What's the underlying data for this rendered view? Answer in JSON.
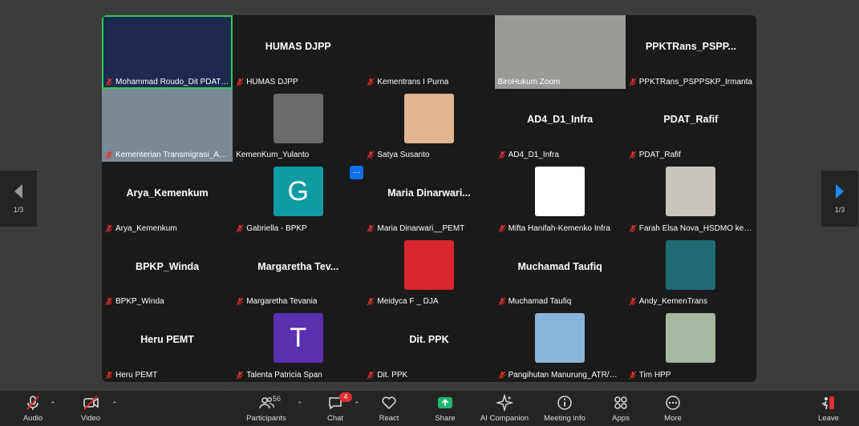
{
  "tiles": [
    {
      "name": "Mohammad Roudo_Dit PDAT Ba...",
      "big": "",
      "kind": "video",
      "bg": "#1d2a4f",
      "active": true
    },
    {
      "name": "HUMAS DJPP",
      "big": "HUMAS DJPP",
      "kind": "name"
    },
    {
      "name": "Kementrans I Purna",
      "big": "",
      "kind": "blank"
    },
    {
      "name": "BiroHukum Zoom",
      "big": "",
      "kind": "video",
      "bg": "#9a9a96",
      "muted": false
    },
    {
      "name": "PPKTRans_PSPPSKP_Irmanta",
      "big": "PPKTRans_PSPP...",
      "kind": "name"
    },
    {
      "name": "Kementerian Transmigrasi_Ab...",
      "big": "",
      "kind": "video",
      "bg": "#7b8a95"
    },
    {
      "name": "KemenKum_Yulanto",
      "big": "",
      "kind": "photo",
      "bg": "#6a6a6a",
      "muted": false
    },
    {
      "name": "Satya Susanto",
      "big": "",
      "kind": "photo",
      "bg": "#e0b590"
    },
    {
      "name": "AD4_D1_Infra",
      "big": "AD4_D1_Infra",
      "kind": "name"
    },
    {
      "name": "PDAT_Rafif",
      "big": "PDAT_Rafif",
      "kind": "name"
    },
    {
      "name": "Arya_Kemenkum",
      "big": "Arya_Kemenkum",
      "kind": "name"
    },
    {
      "name": "Gabriella - BPKP",
      "big": "",
      "kind": "letter",
      "letter": "G",
      "bg": "#0e9ba4"
    },
    {
      "name": "Maria Dinarwari__PEMT",
      "big": "Maria  Dinarwari...",
      "kind": "name"
    },
    {
      "name": "Mifta Hanifah-Kemenko Infra",
      "big": "",
      "kind": "photo",
      "bg": "#ffffff"
    },
    {
      "name": "Farah Elsa Nova_HSDMO kem...",
      "big": "",
      "kind": "photo",
      "bg": "#c9c4bc"
    },
    {
      "name": "BPKP_Winda",
      "big": "BPKP_Winda",
      "kind": "name"
    },
    {
      "name": "Margaretha Tevania",
      "big": "Margaretha  Tev...",
      "kind": "name"
    },
    {
      "name": "Meidyca F _ DJA",
      "big": "",
      "kind": "photo",
      "bg": "#d8262a"
    },
    {
      "name": "Muchamad Taufiq",
      "big": "Muchamad Taufiq",
      "kind": "name"
    },
    {
      "name": "Andy_KemenTrans",
      "big": "",
      "kind": "photo",
      "bg": "#1f6b73"
    },
    {
      "name": "Heru PEMT",
      "big": "Heru PEMT",
      "kind": "name"
    },
    {
      "name": "Talenta Patricia Span",
      "big": "",
      "kind": "letter",
      "letter": "T",
      "bg": "#5a30b0"
    },
    {
      "name": "Dit. PPK",
      "big": "Dit. PPK",
      "kind": "name"
    },
    {
      "name": "Pangihutan Manurung_ATR/BP...",
      "big": "",
      "kind": "photo",
      "bg": "#8ab4d8"
    },
    {
      "name": "Tim HPP",
      "big": "",
      "kind": "photo",
      "bg": "#a8b8a0"
    }
  ],
  "pager": {
    "left": "1/3",
    "right": "1/3"
  },
  "more_dots": "···",
  "toolbar": {
    "audio": "Audio",
    "video": "Video",
    "participants": "Participants",
    "participants_count": "56",
    "chat": "Chat",
    "chat_badge": "4",
    "react": "React",
    "share": "Share",
    "ai": "AI Companion",
    "meeting_info": "Meeting info",
    "apps": "Apps",
    "more": "More",
    "leave": "Leave"
  },
  "colors": {
    "muted": "#e02f2f",
    "active": "#2ecc5a",
    "share": "#22b573",
    "leave": "#e02f2f"
  }
}
